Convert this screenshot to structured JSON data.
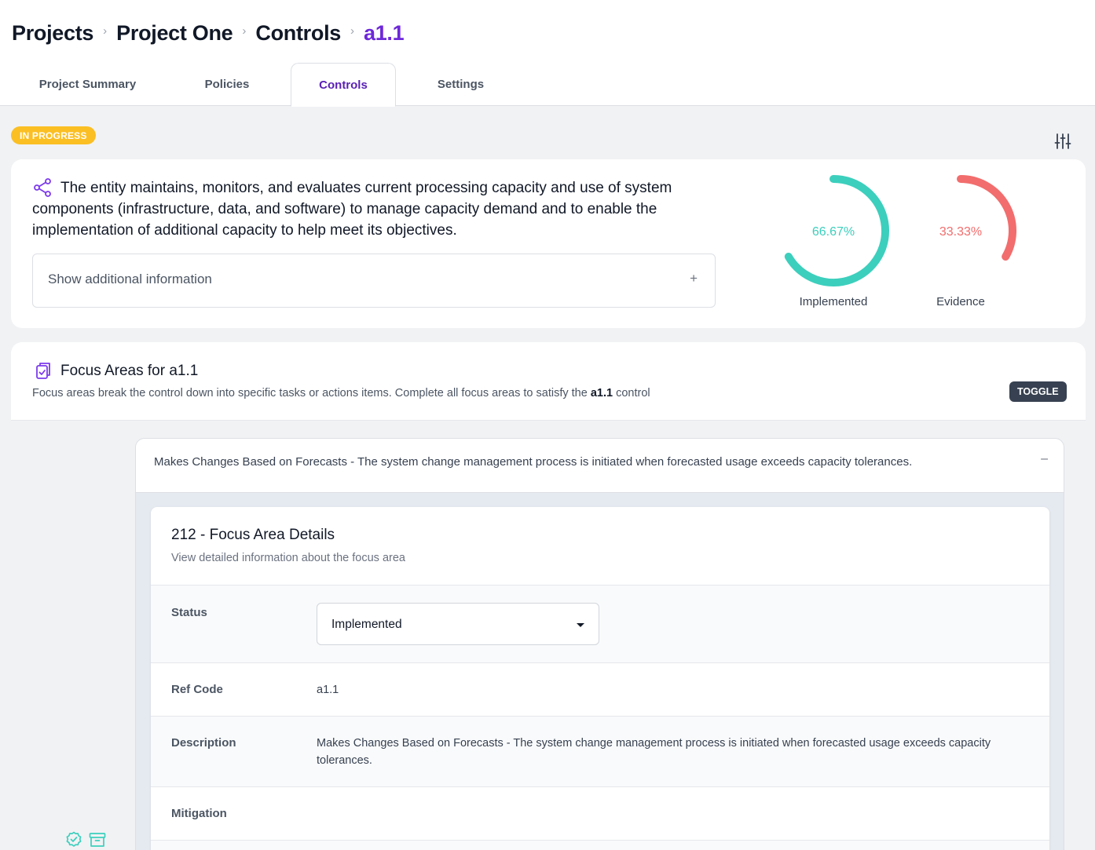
{
  "breadcrumb": [
    "Projects",
    "Project One",
    "Controls",
    "a1.1"
  ],
  "tabs": [
    {
      "label": "Project Summary"
    },
    {
      "label": "Policies"
    },
    {
      "label": "Controls",
      "active": true
    },
    {
      "label": "Settings"
    }
  ],
  "status_badge": "IN PROGRESS",
  "control": {
    "description": "The entity maintains, monitors, and evaluates current processing capacity and use of system components (infrastructure, data, and software) to manage capacity demand and to enable the implementation of additional capacity to help meet its objectives.",
    "additional_info_label": "Show additional information",
    "additional_info_icon": "+"
  },
  "gauges": [
    {
      "value_text": "66.67%",
      "value": 66.67,
      "label": "Implemented",
      "color": "#3ccfbd"
    },
    {
      "value_text": "33.33%",
      "value": 33.33,
      "label": "Evidence",
      "color": "#f26d6d"
    }
  ],
  "focus_areas": {
    "title": "Focus Areas for a1.1",
    "description_prefix": "Focus areas break the control down into specific tasks or actions items. Complete all focus areas to satisfy the ",
    "description_bold": "a1.1",
    "description_suffix": " control",
    "toggle_label": "TOGGLE",
    "item": {
      "title": "Makes Changes Based on Forecasts - The system change management process is initiated when forecasted usage exceeds capacity tolerances.",
      "collapse_icon": "–"
    }
  },
  "details": {
    "title": "212 - Focus Area Details",
    "subtitle": "View detailed information about the focus area",
    "status_label": "Status",
    "status_value": "Implemented",
    "ref_label": "Ref Code",
    "ref_value": "a1.1",
    "description_label": "Description",
    "description_value": "Makes Changes Based on Forecasts - The system change management process is initiated when forecasted usage exceeds capacity tolerances.",
    "mitigation_label": "Mitigation"
  },
  "colors": {
    "accent": "#6d28d9",
    "badge": "#fbbf24",
    "teal": "#3ccfbd",
    "red": "#f26d6d"
  },
  "icons": [
    "share-icon",
    "sliders-icon",
    "clipboard-check-icon",
    "check-badge-icon",
    "archive-icon",
    "chevron-right-icon"
  ]
}
